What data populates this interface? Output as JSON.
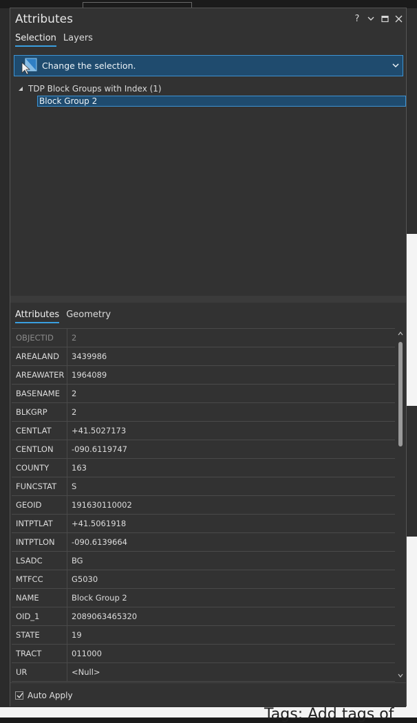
{
  "window": {
    "title": "Attributes",
    "controls": [
      "help-icon",
      "dropdown-icon",
      "maximize-icon",
      "close-icon"
    ],
    "help_glyph": "?"
  },
  "top_tabs": [
    {
      "label": "Selection",
      "active": true
    },
    {
      "label": "Layers",
      "active": false
    }
  ],
  "selection_dropdown": {
    "label": "Change the selection.",
    "icon": "select-cursor-icon"
  },
  "tree": {
    "parent_label": "TDP Block Groups with Index (1)",
    "child_label": "Block Group 2"
  },
  "bottom_tabs": [
    {
      "label": "Attributes",
      "active": true
    },
    {
      "label": "Geometry",
      "active": false
    }
  ],
  "attributes": [
    {
      "name": "OBJECTID",
      "value": "2",
      "readonly": true
    },
    {
      "name": "AREALAND",
      "value": "3439986"
    },
    {
      "name": "AREAWATER",
      "value": "1964089"
    },
    {
      "name": "BASENAME",
      "value": "2"
    },
    {
      "name": "BLKGRP",
      "value": "2"
    },
    {
      "name": "CENTLAT",
      "value": "+41.5027173"
    },
    {
      "name": "CENTLON",
      "value": "-090.6119747"
    },
    {
      "name": "COUNTY",
      "value": "163"
    },
    {
      "name": "FUNCSTAT",
      "value": "S"
    },
    {
      "name": "GEOID",
      "value": "191630110002"
    },
    {
      "name": "INTPTLAT",
      "value": "+41.5061918"
    },
    {
      "name": "INTPTLON",
      "value": "-090.6139664"
    },
    {
      "name": "LSADC",
      "value": "BG"
    },
    {
      "name": "MTFCC",
      "value": "G5030"
    },
    {
      "name": "NAME",
      "value": "Block Group 2"
    },
    {
      "name": "OID_1",
      "value": "2089063465320"
    },
    {
      "name": "STATE",
      "value": "19"
    },
    {
      "name": "TRACT",
      "value": "011000"
    },
    {
      "name": "UR",
      "value": "<Null>"
    }
  ],
  "footer": {
    "auto_apply_label": "Auto Apply",
    "auto_apply_checked": true
  },
  "background": {
    "bottom_text": "Tags: Add tags of"
  },
  "colors": {
    "accent": "#3a9fe0",
    "selection_bg": "#1f4b6e",
    "panel_bg": "#323232"
  }
}
